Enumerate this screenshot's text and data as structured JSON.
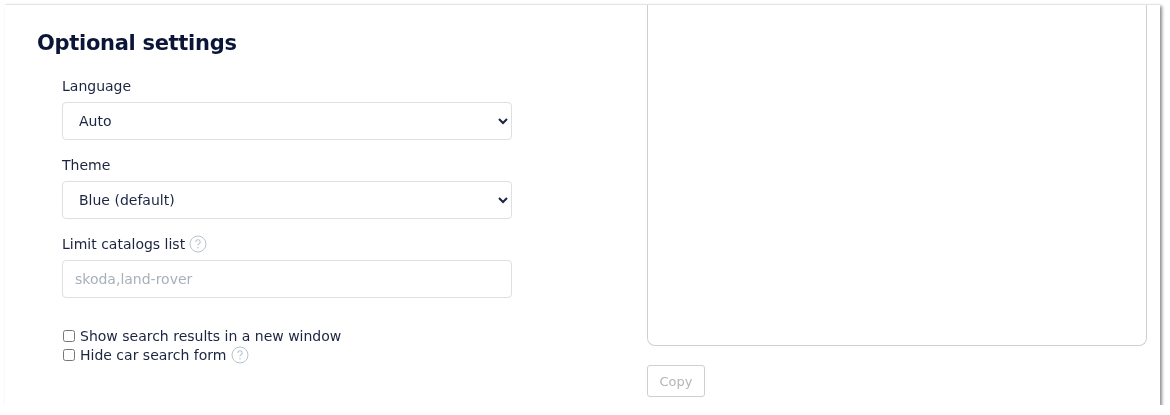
{
  "title": "Optional settings",
  "fields": [
    {
      "kind": "select",
      "label": "Language",
      "value": "Auto",
      "help": false
    },
    {
      "kind": "select",
      "label": "Theme",
      "value": "Blue (default)",
      "help": false
    },
    {
      "kind": "text",
      "label": "Limit catalogs list",
      "placeholder": "skoda,land-rover",
      "help": true
    }
  ],
  "checkboxes": [
    {
      "label": "Show search results in a new window",
      "checked": false,
      "help": false
    },
    {
      "label": "Hide car search form",
      "checked": false,
      "help": true
    }
  ],
  "copy_button": {
    "label": "Copy",
    "disabled": true
  }
}
